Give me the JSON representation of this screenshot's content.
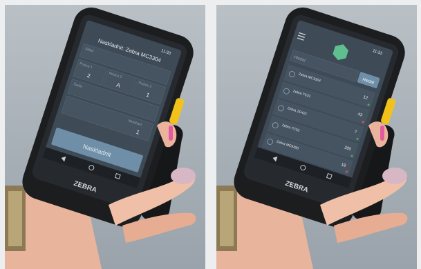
{
  "photos": [
    {
      "screen": {
        "time": "11:33",
        "title": "Naskladnit: Zebra MC3304",
        "fields": [
          {
            "label": "Sklad"
          },
          {
            "label": "Pozice 1",
            "value": "2"
          },
          {
            "label": "Pozice 2",
            "value": "A"
          },
          {
            "label": "Pozice 3",
            "value": "1"
          },
          {
            "label": "Šarže"
          },
          {
            "label": "Množství",
            "value": "1"
          }
        ],
        "action_label": "Naskladnit"
      },
      "brand": "ZEBRA"
    },
    {
      "screen": {
        "time": "11:33",
        "search_placeholder": "Hledat",
        "search_button": "Hledat",
        "list": [
          {
            "title": "Zebra MC3304",
            "value": "12"
          },
          {
            "title": "Zebra TC21",
            "value": "43"
          },
          {
            "title": "Zebra ZD421",
            "value": "7"
          },
          {
            "title": "Zebra TC52",
            "value": "205"
          },
          {
            "title": "Zebra MC9300",
            "value": "18"
          }
        ]
      },
      "brand": "ZEBRA"
    }
  ],
  "colors": {
    "background": "#a7afb6",
    "device_body": "#1c1d1f",
    "screen": "#3e4a56",
    "accent_trigger": "#f2c21a",
    "action_button": "#6f8fa8",
    "nails": "#d7b7c4",
    "status_ok": "#4cb050",
    "status_warn": "#d9534f"
  }
}
